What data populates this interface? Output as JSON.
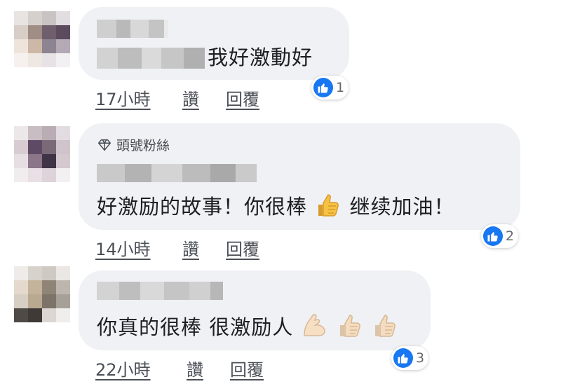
{
  "comments": [
    {
      "text": "我好激動好",
      "time": "17小時",
      "like": "讚",
      "reply": "回覆",
      "reaction_count": "1"
    },
    {
      "badge": "頭號粉絲",
      "text_part1": "好激励的故事！你很棒",
      "text_part2": "继续加油！",
      "time": "14小時",
      "like": "讚",
      "reply": "回覆",
      "reaction_count": "2"
    },
    {
      "text": "你真的很棒 很激励人",
      "time": "22小時",
      "like": "讚",
      "reply": "回覆",
      "reaction_count": "3"
    }
  ],
  "colors": {
    "bubble": "#eff1f4",
    "like_blue": "#1877f2",
    "text": "#1c1e21",
    "meta": "#4b4f56"
  },
  "icons": {
    "badge": "diamond-icon",
    "reaction": "thumbs-up-icon",
    "emoji_thumbs": "thumbs-up-emoji",
    "emoji_muscle": "flexed-biceps-emoji"
  }
}
